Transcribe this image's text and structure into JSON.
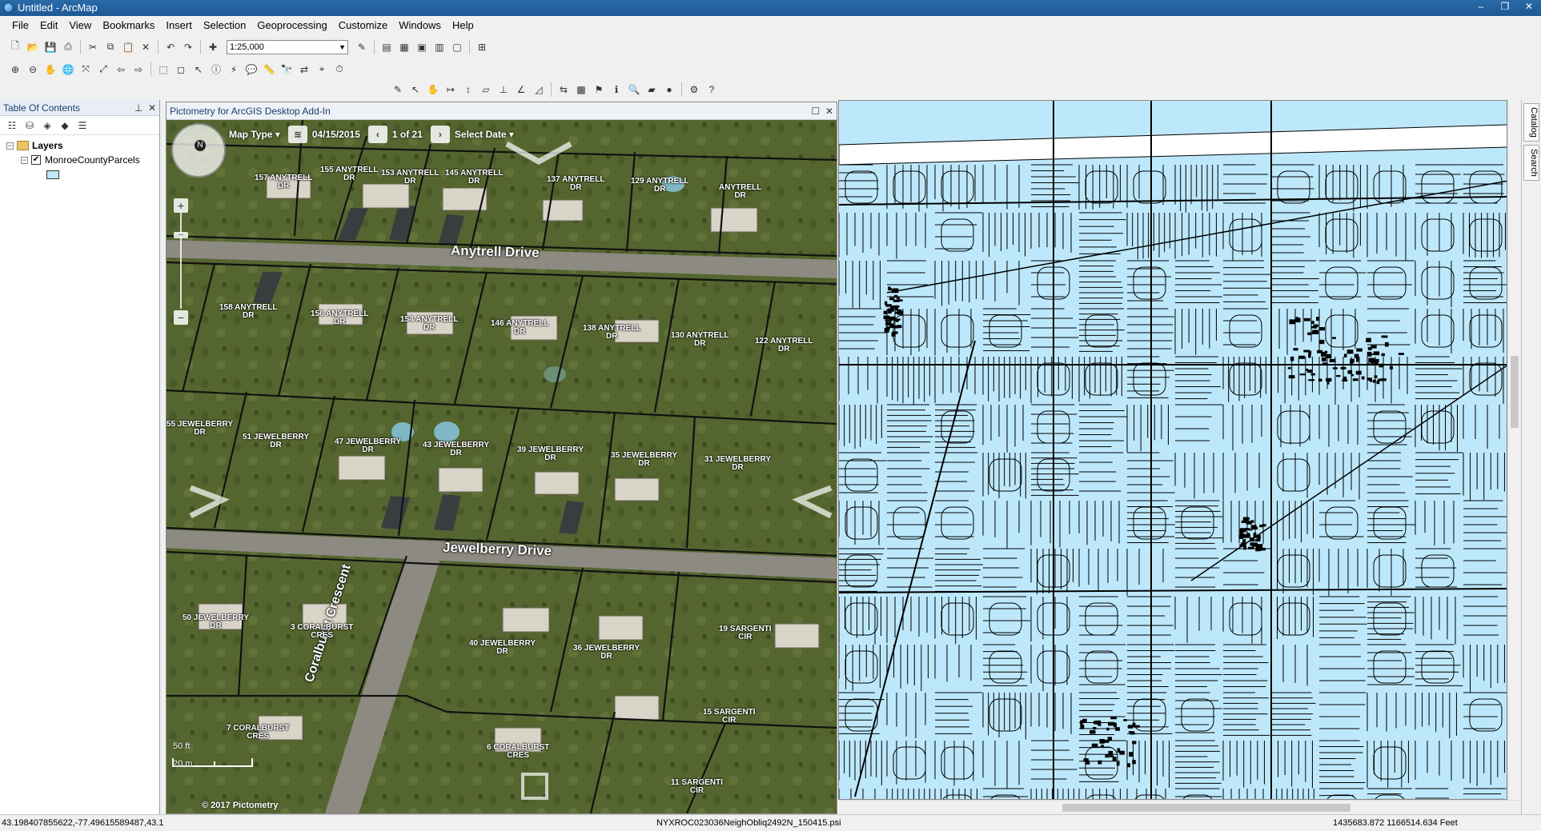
{
  "window": {
    "title": "Untitled - ArcMap",
    "controls": [
      "–",
      "❐",
      "✕"
    ]
  },
  "menu": [
    "File",
    "Edit",
    "View",
    "Bookmarks",
    "Insert",
    "Selection",
    "Geoprocessing",
    "Customize",
    "Windows",
    "Help"
  ],
  "toolbar": {
    "scale": "1:25,000"
  },
  "toc": {
    "title": "Table Of Contents",
    "root_label": "Layers",
    "layer_label": "MonroeCountyParcels",
    "layer_checked": true
  },
  "pictometry": {
    "title": "Pictometry for ArcGIS Desktop Add-In",
    "map_type_label": "Map Type",
    "date": "04/15/2015",
    "image_counter": "1 of 21",
    "select_date_label": "Select Date",
    "compass_letter": "N",
    "roads": [
      "Anytrell Drive",
      "Jewelberry Drive",
      "Coralburst Crescent"
    ],
    "addresses": [
      "157 ANYTRELL\nDR",
      "155 ANYTRELL\nDR",
      "153 ANYTRELL\nDR",
      "145 ANYTRELL\nDR",
      "137 ANYTRELL\nDR",
      "129 ANYTRELL\nDR",
      "ANYTRELL\nDR",
      "158 ANYTRELL\nDR",
      "156 ANYTRELL\nDR",
      "154 ANYTRELL\nDR",
      "146 ANYTRELL\nDR",
      "138 ANYTRELL\nDR",
      "130 ANYTRELL\nDR",
      "122 ANYTRELL\nDR",
      "55 JEWELBERRY\nDR",
      "51 JEWELBERRY\nDR",
      "47 JEWELBERRY\nDR",
      "43 JEWELBERRY\nDR",
      "39 JEWELBERRY\nDR",
      "35 JEWELBERRY\nDR",
      "31 JEWELBERRY\nDR",
      "50 JEWELBERRY\nDR",
      "3 CORALBURST\nCRES",
      "40 JEWELBERRY\nDR",
      "36 JEWELBERRY\nDR",
      "19 SARGENTI\nCIR",
      "7 CORALBURST\nCRES",
      "6 CORALBURST\nCRES",
      "15 SARGENTI\nCIR",
      "11 SARGENTI\nCIR"
    ],
    "scale_ft": "50 ft",
    "scale_m": "20 m",
    "copyright": "© 2017 Pictometry",
    "filename": "NYXROC023036NeighObliq2492N_150415.psi"
  },
  "right_dock": [
    "Catalog",
    "Search"
  ],
  "status": {
    "left_coords": "43.198407855622,-77.49615589487,43.1",
    "right_coords": "1435683.872  1166514.634 Feet"
  },
  "colors": {
    "parcel_fill": "#bde8fb",
    "title_bar": "#1d5895"
  }
}
